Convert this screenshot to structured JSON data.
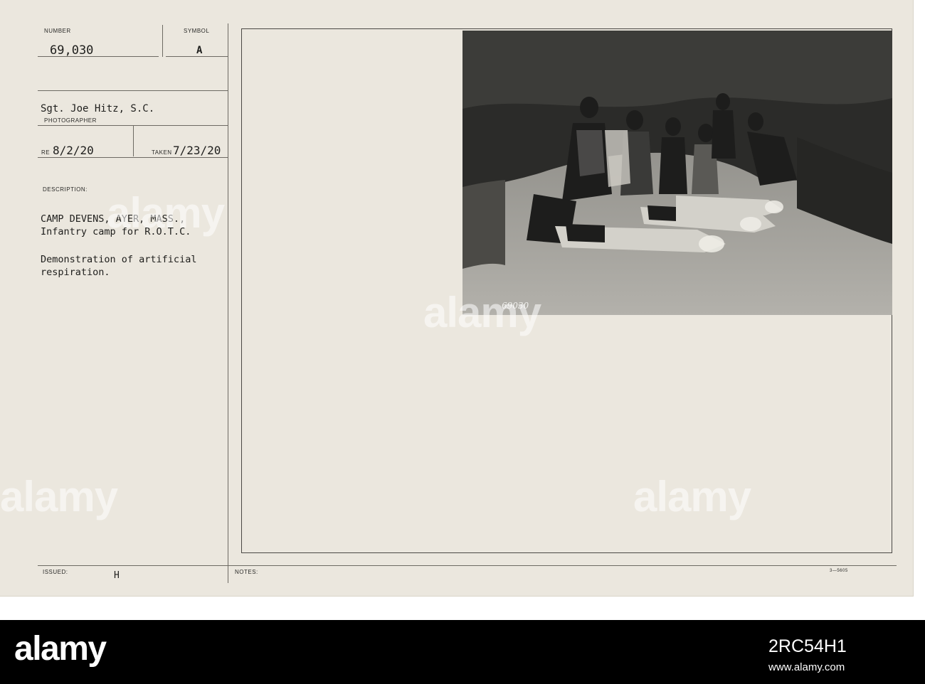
{
  "card": {
    "number_label": "NUMBER",
    "number_value": "69,030",
    "symbol_label": "SYMBOL",
    "symbol_value": "A",
    "photographer_name": "Sgt. Joe Hitz, S.C.",
    "photographer_label": "PHOTOGRAPHER",
    "received_label": "RE",
    "received_value": "8/2/20",
    "taken_label": "TAKEN",
    "taken_value": "7/23/20",
    "description_label": "DESCRIPTION:",
    "description_lines": [
      "CAMP DEVENS, AYER, MASS.,",
      "Infantry camp for R.O.T.C.",
      "",
      "Demonstration of artificial",
      "respiration."
    ],
    "issued_label": "ISSUED:",
    "issued_value": "H",
    "notes_label": "NOTES:",
    "form_number": "3—5605",
    "negative_number": "69030"
  },
  "watermark": {
    "text": "alamy",
    "color": "#ffffff"
  },
  "footer": {
    "logo": "alamy",
    "image_id": "2RC54H1",
    "site": "www.alamy.com",
    "background": "#000000"
  }
}
